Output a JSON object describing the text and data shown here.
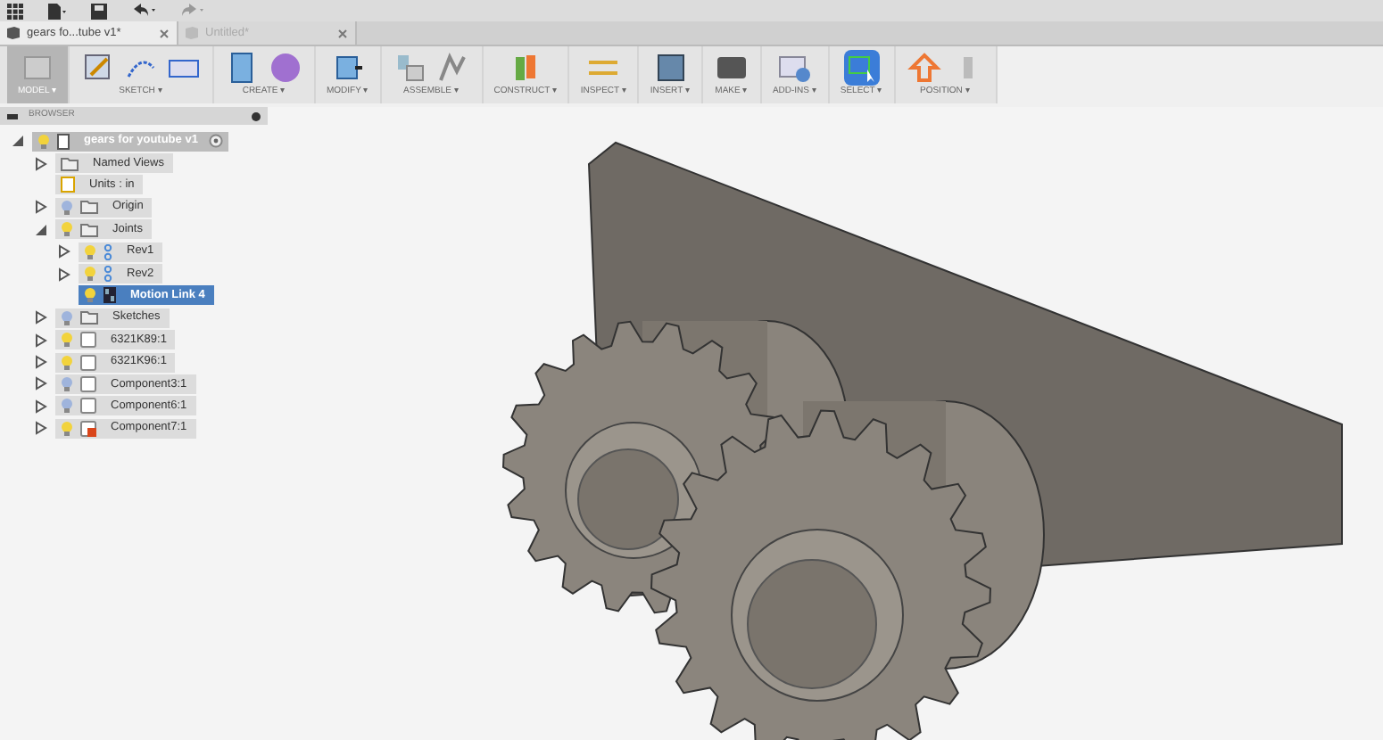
{
  "tabs": [
    {
      "label": "gears fo...tube v1*",
      "selected": true
    },
    {
      "label": "Untitled*",
      "selected": false
    }
  ],
  "toolbar": [
    {
      "label": "MODEL ▾",
      "kind": "model"
    },
    {
      "label": "SKETCH ▾",
      "kind": "sketch"
    },
    {
      "label": "CREATE ▾",
      "kind": "create"
    },
    {
      "label": "MODIFY ▾",
      "kind": "modify"
    },
    {
      "label": "ASSEMBLE ▾",
      "kind": "assemble"
    },
    {
      "label": "CONSTRUCT ▾",
      "kind": "construct"
    },
    {
      "label": "INSPECT ▾",
      "kind": "inspect"
    },
    {
      "label": "INSERT ▾",
      "kind": "insert"
    },
    {
      "label": "MAKE ▾",
      "kind": "make"
    },
    {
      "label": "ADD-INS ▾",
      "kind": "addins"
    },
    {
      "label": "SELECT ▾",
      "kind": "select"
    },
    {
      "label": "POSITION ▾",
      "kind": "position"
    }
  ],
  "browser": {
    "title": "BROWSER",
    "tree": {
      "label": "gears for youtube v1",
      "kind": "document",
      "expanded": true,
      "children": [
        {
          "label": "Named Views",
          "kind": "folder",
          "expanded": false,
          "selected": false
        },
        {
          "label": "Units : in",
          "kind": "units",
          "selected": false
        },
        {
          "label": "Origin",
          "kind": "folder",
          "visible": false,
          "expanded": false,
          "selected": false
        },
        {
          "label": "Joints",
          "kind": "folder",
          "visible": true,
          "expanded": true,
          "selected": false,
          "children": [
            {
              "label": "Rev1",
              "kind": "joint",
              "visible": true,
              "expanded": false,
              "selected": false
            },
            {
              "label": "Rev2",
              "kind": "joint",
              "visible": true,
              "expanded": false,
              "selected": false
            },
            {
              "label": "Motion Link 4",
              "kind": "link",
              "visible": true,
              "selected": true
            }
          ]
        },
        {
          "label": "Sketches",
          "kind": "folder",
          "visible": false,
          "expanded": false,
          "selected": false
        },
        {
          "label": "6321K89:1",
          "kind": "component",
          "visible": true,
          "expanded": false,
          "selected": false
        },
        {
          "label": "6321K96:1",
          "kind": "component",
          "visible": true,
          "expanded": false,
          "selected": false
        },
        {
          "label": "Component3:1",
          "kind": "component",
          "visible": false,
          "expanded": false,
          "selected": false
        },
        {
          "label": "Component6:1",
          "kind": "component",
          "visible": false,
          "expanded": false,
          "selected": false
        },
        {
          "label": "Component7:1",
          "kind": "active-component",
          "visible": true,
          "expanded": false,
          "selected": false
        }
      ]
    }
  }
}
